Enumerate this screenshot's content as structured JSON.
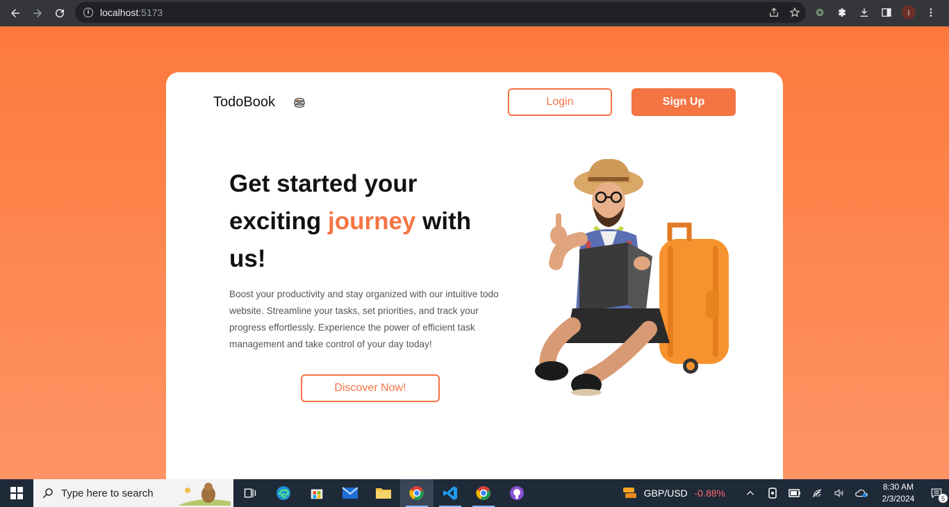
{
  "browser": {
    "url_host": "localhost",
    "url_port": ":5173"
  },
  "header": {
    "brand": "TodoBook",
    "login_label": "Login",
    "signup_label": "Sign Up"
  },
  "hero": {
    "title_part1": "Get started your exciting ",
    "title_accent": "journey",
    "title_part2": " with us!",
    "description": "Boost your productivity and stay organized with our intuitive todo website. Streamline your tasks, set priorities, and track your progress effortlessly. Experience the power of efficient task management and take control of your day today!",
    "cta_label": "Discover Now!"
  },
  "taskbar": {
    "search_placeholder": "Type here to search",
    "ticker_symbol": "GBP/USD",
    "ticker_change": "-0.88%",
    "time": "8:30 AM",
    "date": "2/3/2024",
    "notification_count": "5"
  },
  "colors": {
    "accent": "#f57444",
    "background_top": "#fd7a3c",
    "background_bottom": "#fe9365",
    "taskbar": "#1f2a38",
    "browser_chrome": "#35363a"
  },
  "icons": [
    "back-icon",
    "forward-icon",
    "reload-icon",
    "info-icon",
    "share-icon",
    "star-icon",
    "extension-icon",
    "puzzle-icon",
    "download-icon",
    "sidepanel-icon",
    "profile-avatar",
    "menu-icon",
    "windows-start-icon",
    "search-icon",
    "task-view-icon",
    "edge-icon",
    "store-icon",
    "mail-icon",
    "file-explorer-icon",
    "chrome-icon",
    "vscode-icon",
    "github-icon",
    "chevron-up-icon",
    "wifi-icon",
    "battery-icon",
    "volume-icon",
    "notification-icon"
  ]
}
